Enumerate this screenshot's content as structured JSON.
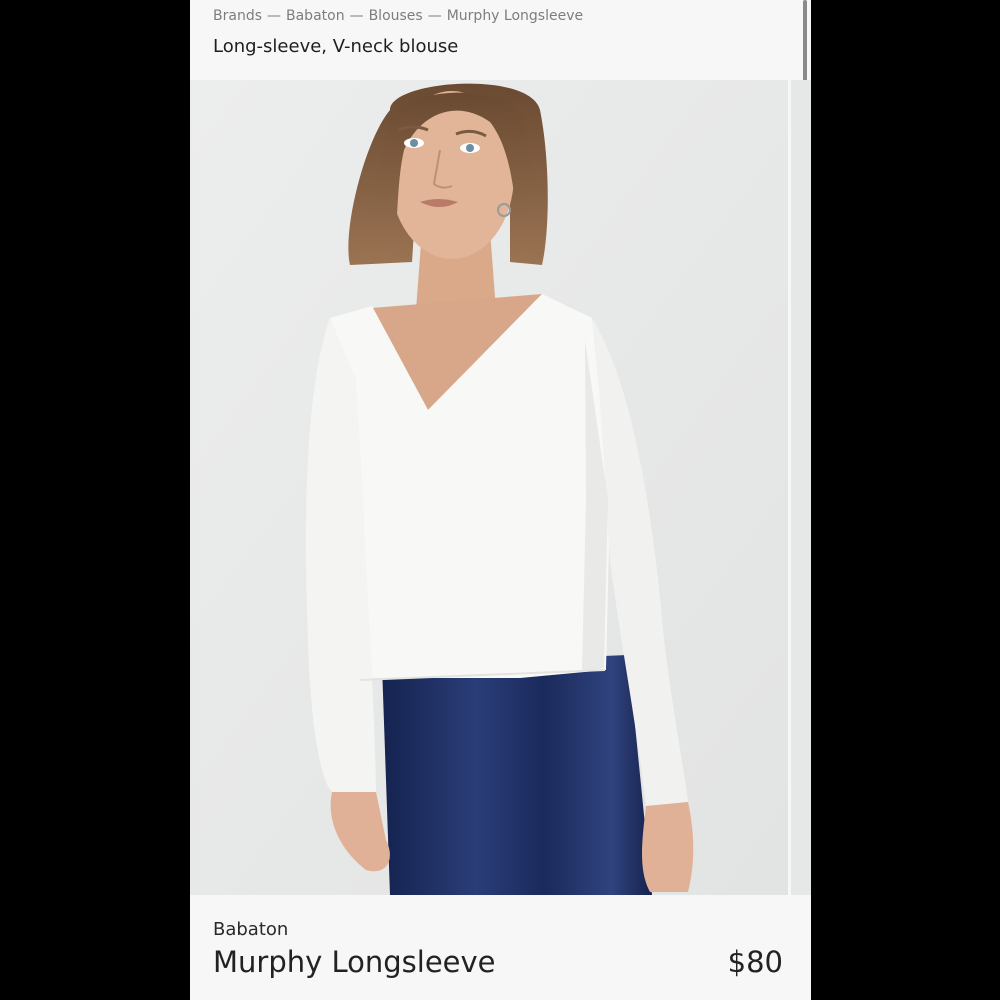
{
  "breadcrumb": {
    "items": [
      "Brands",
      "Babaton",
      "Blouses",
      "Murphy Longsleeve"
    ],
    "separator": "—"
  },
  "header": {
    "title": "Long-sleeve, V-neck blouse"
  },
  "product": {
    "brand": "Babaton",
    "name": "Murphy Longsleeve",
    "price": "$80"
  },
  "colors": {
    "background": "#f7f7f7",
    "photo_backdrop": "#e9eaea",
    "blouse": "#f8f8f7",
    "skirt": "#1a2a5c"
  }
}
